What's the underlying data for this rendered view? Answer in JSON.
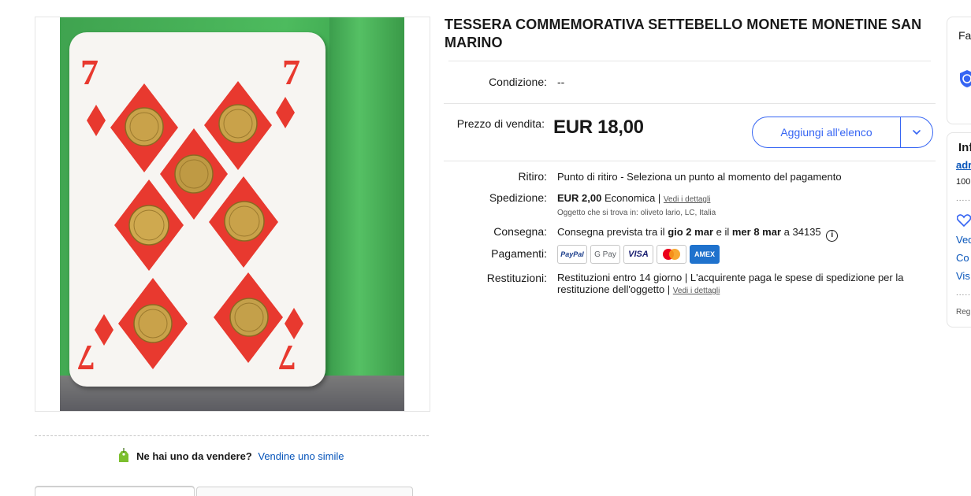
{
  "item": {
    "title": "TESSERA COMMEMORATIVA SETTEBELLO MONETE MONETINE SAN MARINO",
    "condition_label": "Condizione:",
    "condition_value": "--",
    "price_label": "Prezzo di vendita:",
    "price": "EUR 18,00",
    "add_to_list": "Aggiungi all'elenco"
  },
  "photo": {
    "card_rank": "7"
  },
  "details": {
    "ritiro_label": "Ritiro:",
    "ritiro_value": "Punto di ritiro - Seleziona un punto al momento del pagamento",
    "spedizione_label": "Spedizione:",
    "spedizione_price": "EUR 2,00",
    "spedizione_type": "Economica |",
    "spedizione_link": "Vedi i dettagli",
    "location": "Oggetto che si trova in: oliveto lario, LC, Italia",
    "consegna_label": "Consegna:",
    "consegna_prefix": "Consegna prevista tra il",
    "consegna_from": "gio 2 mar",
    "consegna_mid": "e il",
    "consegna_to": "mer 8 mar",
    "consegna_suffix": "a 34135",
    "pagamenti_label": "Pagamenti:",
    "payments": [
      "PayPal",
      "G Pay",
      "VISA",
      "",
      "AMEX"
    ],
    "restituzioni_label": "Restituzioni:",
    "restituzioni_value": "Restituzioni entro 14 giorno | L'acquirente paga le spese di spedizione per la restituzione dell'oggetto |",
    "restituzioni_link": "Vedi i dettagli"
  },
  "sell": {
    "question": "Ne hai uno da vendere?",
    "link": "Vendine uno simile"
  },
  "side": {
    "card1_title": "Fa",
    "card2_title": "Inf",
    "seller_link": "adr",
    "seller_pct": "100",
    "link_a": "Ved",
    "link_b": "Co",
    "link_c": "Vis",
    "footer": "Reg"
  },
  "colors": {
    "accent": "#3665f3",
    "link": "#0654ba",
    "diamond_red": "#e8392f",
    "coin_gold": "#c9a24a"
  }
}
